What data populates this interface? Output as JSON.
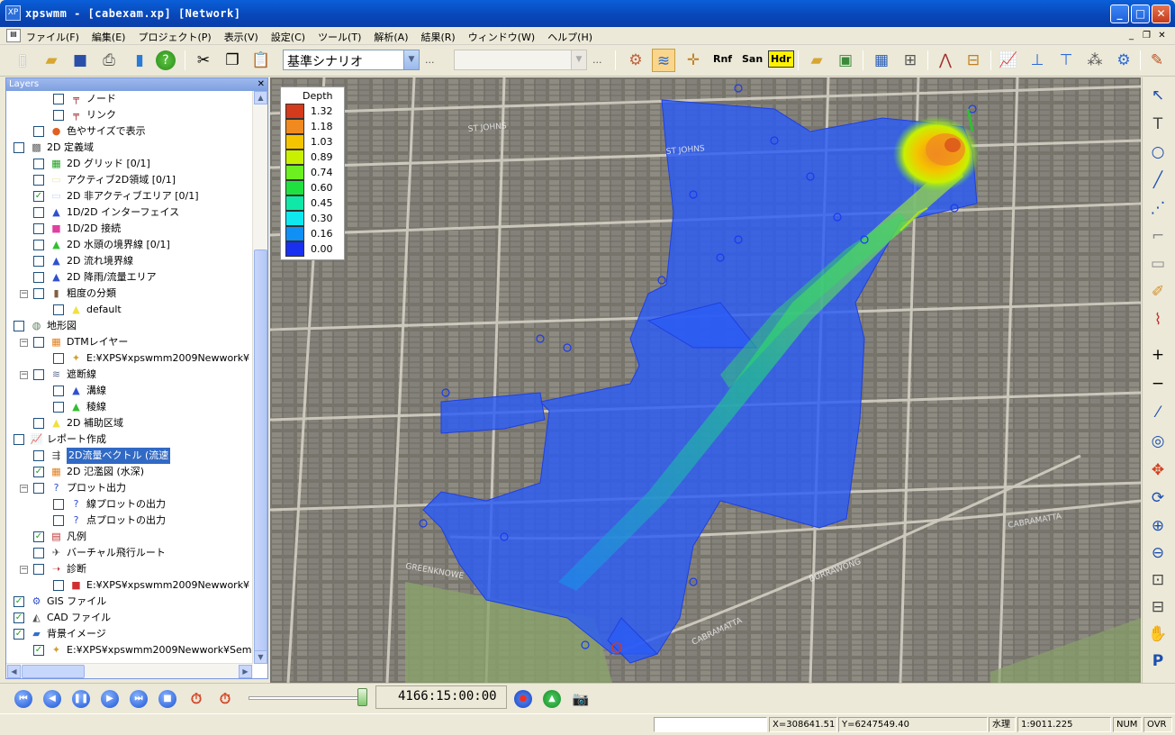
{
  "window": {
    "title": "xpswmm - [cabexam.xp] [Network]",
    "app_icon": "XP"
  },
  "menu": [
    "ファイル(F)",
    "編集(E)",
    "プロジェクト(P)",
    "表示(V)",
    "設定(C)",
    "ツール(T)",
    "解析(A)",
    "結果(R)",
    "ウィンドウ(W)",
    "ヘルプ(H)"
  ],
  "toolbar": {
    "scenario": "基準シナリオ",
    "scenario2": "",
    "ellipsis": "...",
    "rnf": "Rnf",
    "san": "San",
    "hdr": "Hdr"
  },
  "layers": {
    "panel_title": "Layers",
    "rows": [
      {
        "label": "ノード",
        "checked": false
      },
      {
        "label": "リンク",
        "checked": false
      },
      {
        "label": "色やサイズで表示",
        "checked": false
      },
      {
        "label": "2D 定義域",
        "checked": false
      },
      {
        "label": "2D グリッド [0/1]",
        "checked": false
      },
      {
        "label": "アクティブ2D領域 [0/1]",
        "checked": false
      },
      {
        "label": "2D 非アクティブエリア [0/1]",
        "checked": true
      },
      {
        "label": "1D/2D インターフェイス",
        "checked": false
      },
      {
        "label": "1D/2D 接続",
        "checked": false
      },
      {
        "label": "2D 水頭の境界線 [0/1]",
        "checked": false
      },
      {
        "label": "2D 流れ境界線",
        "checked": false
      },
      {
        "label": "2D 降雨/流量エリア",
        "checked": false
      },
      {
        "label": "粗度の分類",
        "checked": false
      },
      {
        "label": "default",
        "checked": false
      },
      {
        "label": "地形図",
        "checked": false
      },
      {
        "label": "DTMレイヤー",
        "checked": false
      },
      {
        "label": "E:¥XPS¥xpswmm2009Newwork¥",
        "checked": false
      },
      {
        "label": "遮断線",
        "checked": false
      },
      {
        "label": "溝線",
        "checked": false
      },
      {
        "label": "稜線",
        "checked": false
      },
      {
        "label": "2D 補助区域",
        "checked": false
      },
      {
        "label": "レポート作成",
        "checked": false
      },
      {
        "label": "2D流量ベクトル (流速",
        "checked": false
      },
      {
        "label": "2D 氾濫図 (水深)",
        "checked": true
      },
      {
        "label": "プロット出力",
        "checked": false
      },
      {
        "label": "線プロットの出力",
        "checked": false
      },
      {
        "label": "点プロットの出力",
        "checked": false
      },
      {
        "label": "凡例",
        "checked": true
      },
      {
        "label": "バーチャル飛行ルート",
        "checked": false
      },
      {
        "label": "診断",
        "checked": false
      },
      {
        "label": "E:¥XPS¥xpswmm2009Newwork¥",
        "checked": false
      },
      {
        "label": "GIS ファイル",
        "checked": true
      },
      {
        "label": "CAD ファイル",
        "checked": true
      },
      {
        "label": "背景イメージ",
        "checked": true
      },
      {
        "label": "E:¥XPS¥xpswmm2009Newwork¥Sem",
        "checked": true
      }
    ]
  },
  "legend": {
    "title": "Depth",
    "entries": [
      {
        "value": "1.32",
        "color": "#d43a1c"
      },
      {
        "value": "1.18",
        "color": "#f08a20"
      },
      {
        "value": "1.03",
        "color": "#f5c400"
      },
      {
        "value": "0.89",
        "color": "#c8f000"
      },
      {
        "value": "0.74",
        "color": "#6cf020"
      },
      {
        "value": "0.60",
        "color": "#20e040"
      },
      {
        "value": "0.45",
        "color": "#10e8a8"
      },
      {
        "value": "0.30",
        "color": "#10e8f0"
      },
      {
        "value": "0.16",
        "color": "#1090f5"
      },
      {
        "value": "0.00",
        "color": "#1a30f0"
      }
    ]
  },
  "map_labels": [
    "ST JOHNS",
    "ST JOHNS",
    "CABRAMATTA",
    "CABRAMATTA",
    "BURRAWONG",
    "GREENKNOWE"
  ],
  "playback": {
    "time": "4166:15:00:00"
  },
  "status": {
    "x": "X=308641.51",
    "y": "Y=6247549.40",
    "water": "水理",
    "scale": "1:9011.225",
    "num": "NUM",
    "ovr": "OVR"
  }
}
